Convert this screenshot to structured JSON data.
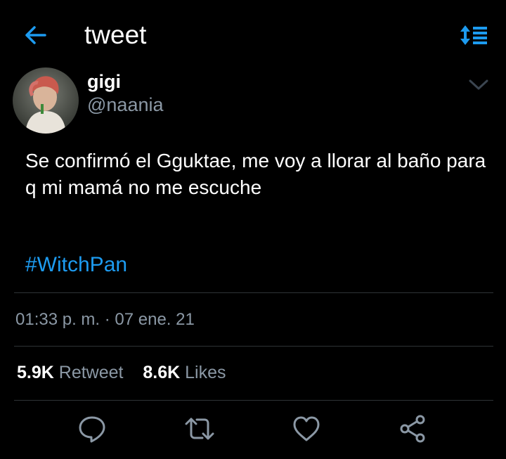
{
  "header": {
    "title": "tweet",
    "accent_color": "#1d9bf0",
    "back_icon": "arrow-left-icon",
    "sort_icon": "sort-list-icon"
  },
  "tweet": {
    "author_name": "gigi",
    "author_handle": "@naania",
    "text": "Se confirmó el Gguktae, me voy a llorar al baño para q mi mamá no me escuche",
    "hashtag": "#WitchPan",
    "timestamp": "01:33 p. m. · 07 ene. 21",
    "retweet_count": "5.9K",
    "retweet_label": "Retweet",
    "like_count": "8.6K",
    "like_label": "Likes"
  },
  "actions": [
    "reply-icon",
    "retweet-icon",
    "heart-icon",
    "share-icon"
  ],
  "colors": {
    "background": "#000000",
    "secondary_text": "#8b98a5",
    "divider": "#2f3336"
  }
}
